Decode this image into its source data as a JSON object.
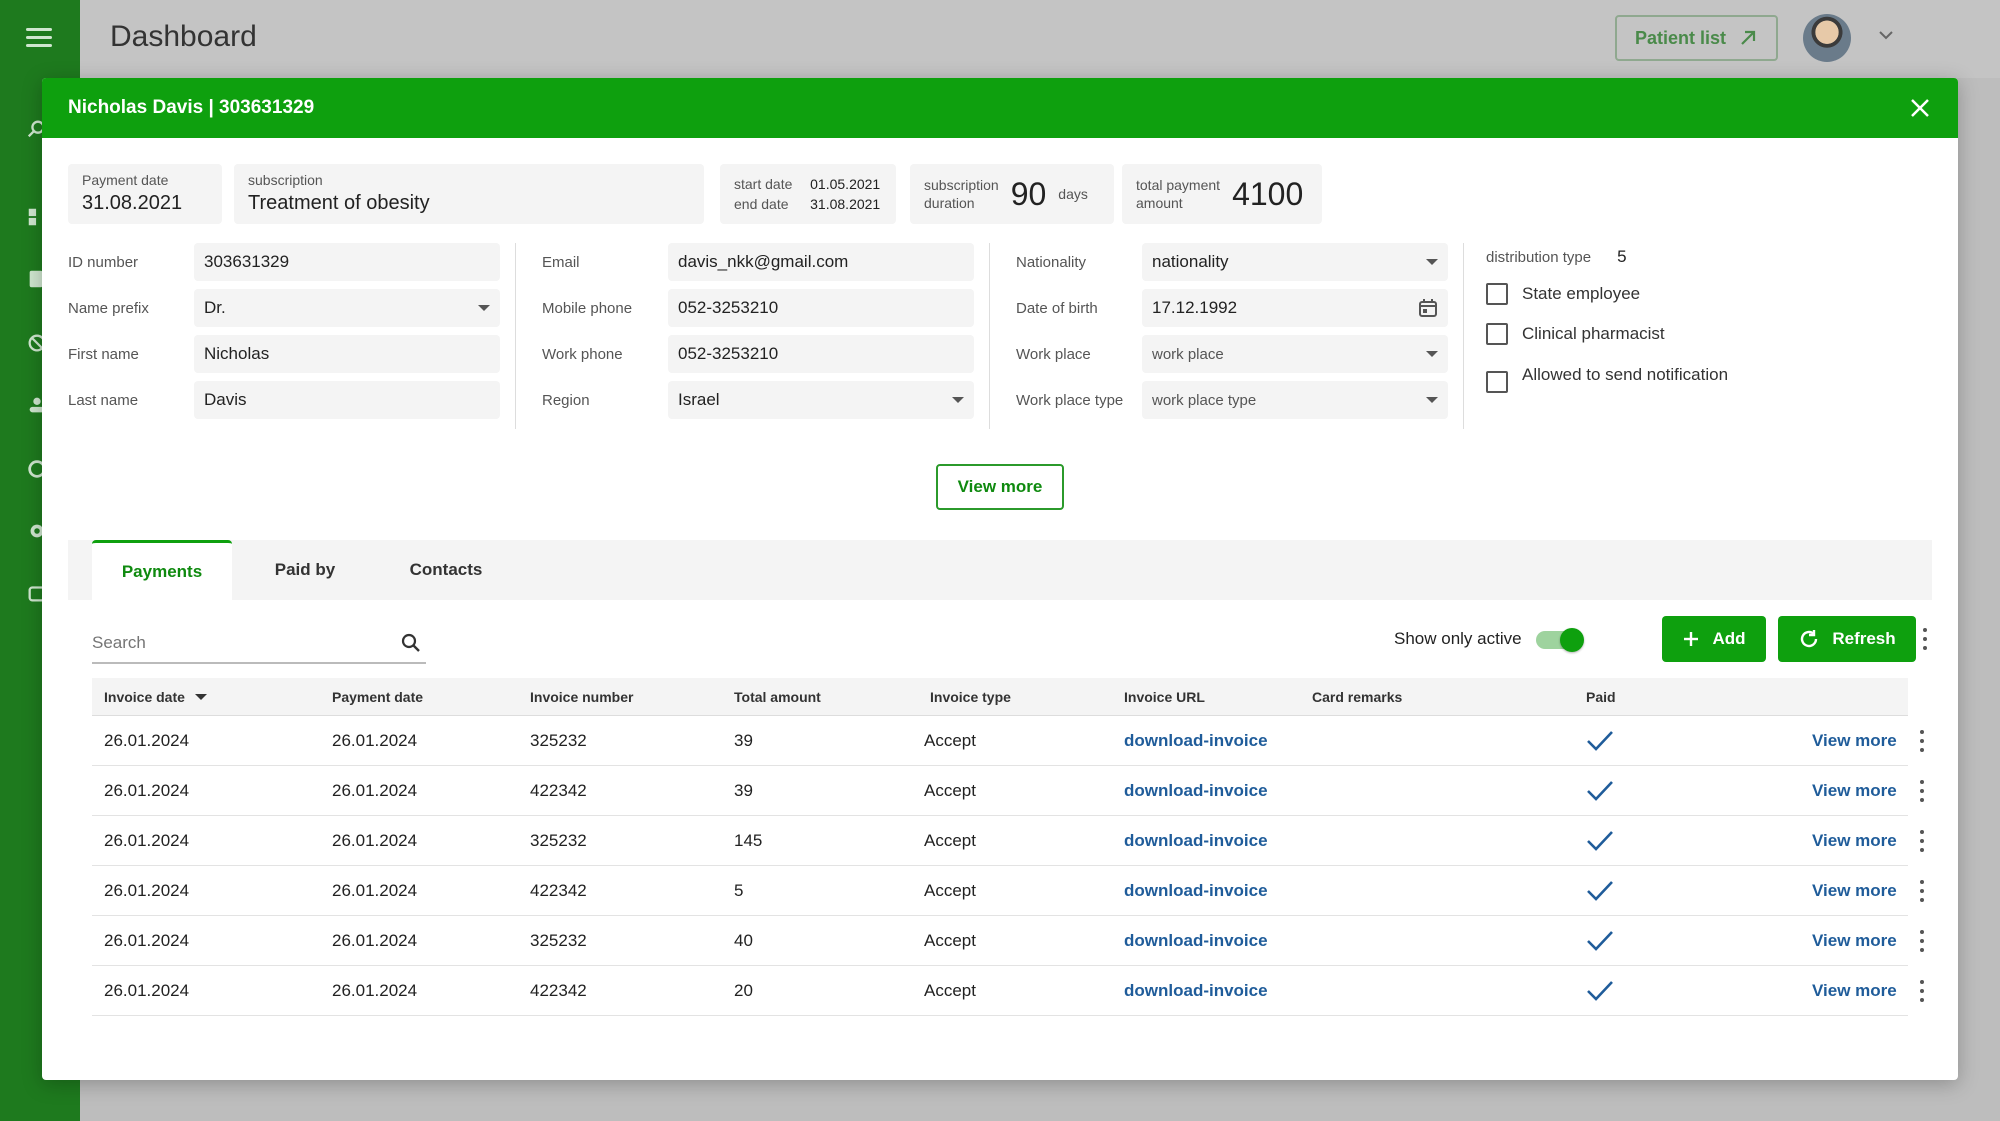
{
  "app": {
    "title": "Dashboard",
    "patient_list_label": "Patient list"
  },
  "modal": {
    "title": "Nicholas Davis | 303631329",
    "summary": {
      "payment_date_label": "Payment date",
      "payment_date": "31.08.2021",
      "subscription_label": "subscription",
      "subscription": "Treatment of obesity",
      "start_date_label": "start date",
      "start_date": "01.05.2021",
      "end_date_label": "end date",
      "end_date": "31.08.2021",
      "duration_label_1": "subscription",
      "duration_label_2": "duration",
      "duration_value": "90",
      "duration_unit": "days",
      "total_label_1": "total payment",
      "total_label_2": "amount",
      "total_value": "4100"
    },
    "form": {
      "col1": [
        {
          "label": "ID number",
          "value": "303631329",
          "type": "text"
        },
        {
          "label": "Name prefix",
          "value": "Dr.",
          "type": "select"
        },
        {
          "label": "First name",
          "value": "Nicholas",
          "type": "text"
        },
        {
          "label": "Last name",
          "value": "Davis",
          "type": "text"
        }
      ],
      "col2": [
        {
          "label": "Email",
          "value": "davis_nkk@gmail.com",
          "type": "text"
        },
        {
          "label": "Mobile phone",
          "value": "052-3253210",
          "type": "text"
        },
        {
          "label": "Work phone",
          "value": "052-3253210",
          "type": "text"
        },
        {
          "label": "Region",
          "value": "Israel",
          "type": "select"
        }
      ],
      "col3": [
        {
          "label": "Nationality",
          "value": "nationality",
          "type": "select"
        },
        {
          "label": "Date of birth",
          "value": "17.12.1992",
          "type": "date"
        },
        {
          "label": "Work place",
          "value": "work place",
          "type": "select"
        },
        {
          "label": "Work place type",
          "value": "work place type",
          "type": "select"
        }
      ],
      "distribution_type_label": "distribution type",
      "distribution_type_value": "5",
      "checkboxes": [
        "State employee",
        "Clinical pharmacist",
        "Allowed to send notification"
      ]
    },
    "view_more_label": "View more",
    "tabs": [
      "Payments",
      "Paid by",
      "Contacts"
    ],
    "toolbar": {
      "search_placeholder": "Search",
      "show_only_active_label": "Show only active",
      "add_label": "Add",
      "refresh_label": "Refresh"
    },
    "table": {
      "columns": [
        "Invoice date",
        "Payment date",
        "Invoice number",
        "Total amount",
        "Invoice type",
        "Invoice URL",
        "Card remarks",
        "Paid"
      ],
      "rows": [
        {
          "invoice_date": "26.01.2024",
          "payment_date": "26.01.2024",
          "invoice_number": "325232",
          "total": "39",
          "type": "Accept",
          "url": "download-invoice",
          "remarks": "",
          "paid": true,
          "action": "View more"
        },
        {
          "invoice_date": "26.01.2024",
          "payment_date": "26.01.2024",
          "invoice_number": "422342",
          "total": "39",
          "type": "Accept",
          "url": "download-invoice",
          "remarks": "",
          "paid": true,
          "action": "View more"
        },
        {
          "invoice_date": "26.01.2024",
          "payment_date": "26.01.2024",
          "invoice_number": "325232",
          "total": "145",
          "type": "Accept",
          "url": "download-invoice",
          "remarks": "",
          "paid": true,
          "action": "View more"
        },
        {
          "invoice_date": "26.01.2024",
          "payment_date": "26.01.2024",
          "invoice_number": "422342",
          "total": "5",
          "type": "Accept",
          "url": "download-invoice",
          "remarks": "",
          "paid": true,
          "action": "View more"
        },
        {
          "invoice_date": "26.01.2024",
          "payment_date": "26.01.2024",
          "invoice_number": "325232",
          "total": "40",
          "type": "Accept",
          "url": "download-invoice",
          "remarks": "",
          "paid": true,
          "action": "View more"
        },
        {
          "invoice_date": "26.01.2024",
          "payment_date": "26.01.2024",
          "invoice_number": "422342",
          "total": "20",
          "type": "Accept",
          "url": "download-invoice",
          "remarks": "",
          "paid": true,
          "action": "View more"
        }
      ]
    }
  },
  "colors": {
    "brand_green": "#0ea00e",
    "sidebar_green": "#1e7a1e",
    "link_blue": "#1f5c9a"
  }
}
